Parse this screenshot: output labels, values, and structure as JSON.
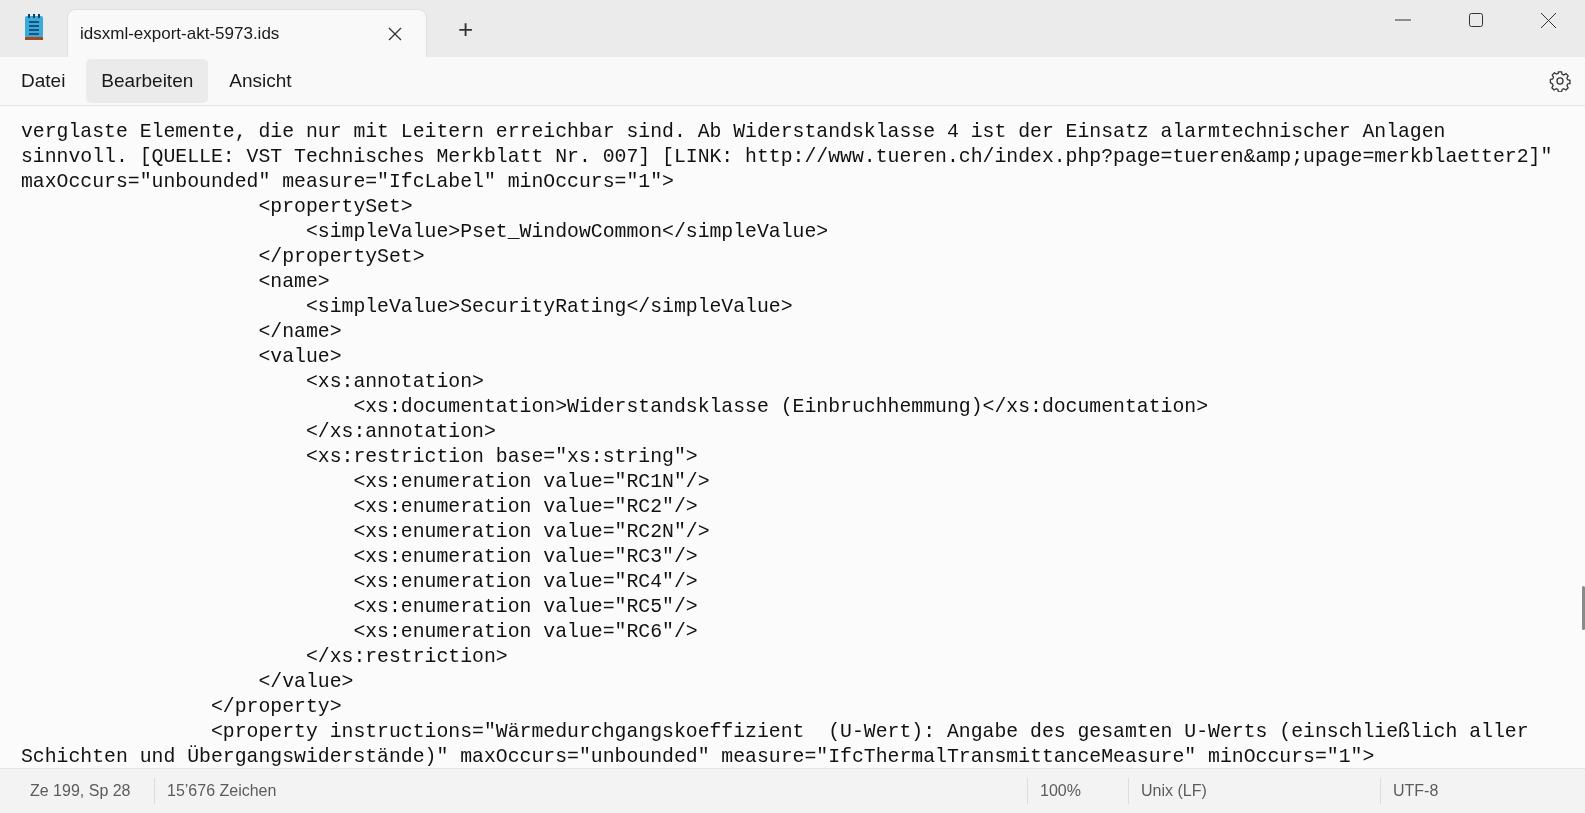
{
  "window": {
    "tabs": [
      {
        "label": "idsxml-export-akt-5973.ids",
        "selected": true
      }
    ],
    "new_tab": "+"
  },
  "menu": [
    {
      "label": "Datei",
      "highlighted": false
    },
    {
      "label": "Bearbeiten",
      "highlighted": true
    },
    {
      "label": "Ansicht",
      "highlighted": false
    }
  ],
  "editor": {
    "lines": [
      "verglaste Elemente, die nur mit Leitern erreichbar sind. Ab Widerstandsklasse 4 ist der Einsatz alarmtechnischer Anlagen",
      "sinnvoll. [QUELLE: VST Technisches Merkblatt Nr. 007] [LINK: http://www.tueren.ch/index.php?page=tueren&amp;upage=merkblaetter2]\"",
      "maxOccurs=\"unbounded\" measure=\"IfcLabel\" minOccurs=\"1\">",
      "                    <propertySet>",
      "                        <simpleValue>Pset_WindowCommon</simpleValue>",
      "                    </propertySet>",
      "                    <name>",
      "                        <simpleValue>SecurityRating</simpleValue>",
      "                    </name>",
      "                    <value>",
      "                        <xs:annotation>",
      "                            <xs:documentation>Widerstandsklasse (Einbruchhemmung)</xs:documentation>",
      "                        </xs:annotation>",
      "                        <xs:restriction base=\"xs:string\">",
      "                            <xs:enumeration value=\"RC1N\"/>",
      "                            <xs:enumeration value=\"RC2\"/>",
      "                            <xs:enumeration value=\"RC2N\"/>",
      "                            <xs:enumeration value=\"RC3\"/>",
      "                            <xs:enumeration value=\"RC4\"/>",
      "                            <xs:enumeration value=\"RC5\"/>",
      "                            <xs:enumeration value=\"RC6\"/>",
      "                        </xs:restriction>",
      "                    </value>",
      "                </property>",
      "                <property instructions=\"Wärmedurchgangskoeffizient  (U-Wert): Angabe des gesamten U-Werts (einschließlich aller",
      "Schichten und Übergangswiderstände)\" maxOccurs=\"unbounded\" measure=\"IfcThermalTransmittanceMeasure\" minOccurs=\"1\">"
    ]
  },
  "status_bar": [
    {
      "text": "Ze 199, Sp 28"
    },
    {
      "text": "15’676 Zeichen"
    },
    {
      "text": "100%"
    },
    {
      "text": "Unix (LF)"
    },
    {
      "text": "UTF-8"
    }
  ]
}
